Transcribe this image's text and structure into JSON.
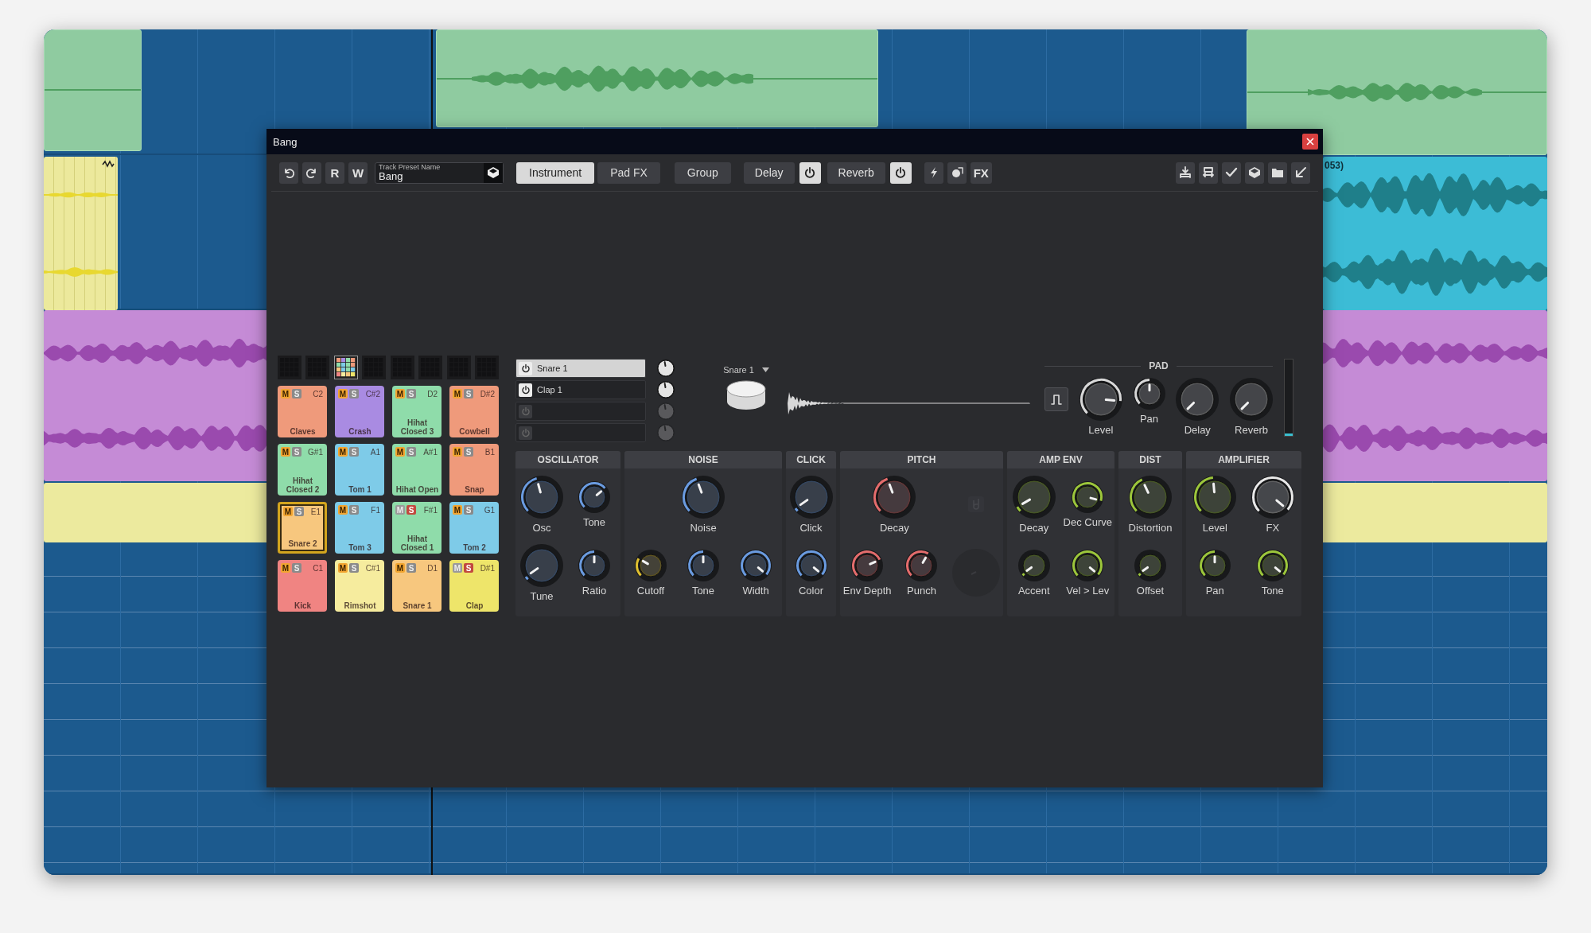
{
  "daw": {
    "clip_label": "053)"
  },
  "window": {
    "title": "Bang"
  },
  "toolbar": {
    "letter_buttons": [
      "R",
      "W"
    ],
    "preset": {
      "label": "Track Preset Name",
      "value": "Bang"
    },
    "tabs": [
      {
        "label": "Instrument",
        "selected": true
      },
      {
        "label": "Pad FX",
        "selected": false
      },
      {
        "label": "Group",
        "selected": false
      }
    ],
    "effects": [
      {
        "label": "Delay",
        "on": true
      },
      {
        "label": "Reverb",
        "on": true
      }
    ],
    "fx_label": "FX"
  },
  "banks": [
    {
      "selected": false
    },
    {
      "selected": false
    },
    {
      "selected": true
    },
    {
      "selected": false
    },
    {
      "selected": false
    },
    {
      "selected": false
    },
    {
      "selected": false
    },
    {
      "selected": false
    }
  ],
  "pads": [
    {
      "m": "M",
      "s": "S",
      "note": "C2",
      "name": "Claves",
      "color": "#ef9a7b",
      "m_on": true,
      "s_on": false,
      "selected": false
    },
    {
      "m": "M",
      "s": "S",
      "note": "C#2",
      "name": "Crash",
      "color": "#a98be2",
      "m_on": true,
      "s_on": false,
      "selected": false
    },
    {
      "m": "M",
      "s": "S",
      "note": "D2",
      "name": "Hihat Closed 3",
      "color": "#8fdcaa",
      "m_on": true,
      "s_on": false,
      "selected": false
    },
    {
      "m": "M",
      "s": "S",
      "note": "D#2",
      "name": "Cowbell",
      "color": "#ef9a7b",
      "m_on": true,
      "s_on": false,
      "selected": false
    },
    {
      "m": "M",
      "s": "S",
      "note": "G#1",
      "name": "Hihat Closed 2",
      "color": "#8fdcaa",
      "m_on": true,
      "s_on": false,
      "selected": false
    },
    {
      "m": "M",
      "s": "S",
      "note": "A1",
      "name": "Tom 1",
      "color": "#7ecbe8",
      "m_on": true,
      "s_on": false,
      "selected": false
    },
    {
      "m": "M",
      "s": "S",
      "note": "A#1",
      "name": "Hihat Open",
      "color": "#8fdcaa",
      "m_on": true,
      "s_on": false,
      "selected": false
    },
    {
      "m": "M",
      "s": "S",
      "note": "B1",
      "name": "Snap",
      "color": "#ef9a7b",
      "m_on": true,
      "s_on": false,
      "selected": false
    },
    {
      "m": "M",
      "s": "S",
      "note": "E1",
      "name": "Snare 2",
      "color": "#f7c77e",
      "m_on": true,
      "s_on": false,
      "selected": true
    },
    {
      "m": "M",
      "s": "S",
      "note": "F1",
      "name": "Tom 3",
      "color": "#7ecbe8",
      "m_on": true,
      "s_on": false,
      "selected": false
    },
    {
      "m": "M",
      "s": "S",
      "note": "F#1",
      "name": "Hihat Closed 1",
      "color": "#8fdcaa",
      "m_on": false,
      "s_on": true,
      "selected": false
    },
    {
      "m": "M",
      "s": "S",
      "note": "G1",
      "name": "Tom 2",
      "color": "#7ecbe8",
      "m_on": true,
      "s_on": false,
      "selected": false
    },
    {
      "m": "M",
      "s": "S",
      "note": "C1",
      "name": "Kick",
      "color": "#f08482",
      "m_on": true,
      "s_on": false,
      "selected": false
    },
    {
      "m": "M",
      "s": "S",
      "note": "C#1",
      "name": "Rimshot",
      "color": "#f6ec9e",
      "m_on": true,
      "s_on": false,
      "selected": false
    },
    {
      "m": "M",
      "s": "S",
      "note": "D1",
      "name": "Snare 1",
      "color": "#f7c77e",
      "m_on": true,
      "s_on": false,
      "selected": false
    },
    {
      "m": "M",
      "s": "S",
      "note": "D#1",
      "name": "Clap",
      "color": "#eee56a",
      "m_on": false,
      "s_on": true,
      "selected": false
    }
  ],
  "layers": [
    {
      "label": "Snare 1",
      "on": true,
      "selected": true
    },
    {
      "label": "Clap 1",
      "on": true,
      "selected": false
    },
    {
      "on": false,
      "selected": false
    },
    {
      "on": false,
      "selected": false
    }
  ],
  "sample": {
    "name": "Snare 1"
  },
  "pad": {
    "title": "PAD",
    "knobs": [
      {
        "label": "Level",
        "kind": "large"
      },
      {
        "label": "Pan",
        "kind": "small"
      },
      {
        "label": "Delay",
        "kind": "large"
      },
      {
        "label": "Reverb",
        "kind": "large"
      }
    ],
    "meter": {
      "level": 0.03
    }
  },
  "sections": [
    {
      "title": "OSCILLATOR",
      "rows": [
        [
          {
            "label": "Osc",
            "kind": "large"
          },
          {
            "label": "Tone",
            "kind": "small"
          }
        ],
        [
          {
            "label": "Tune",
            "kind": "large"
          },
          {
            "label": "Ratio",
            "kind": "small"
          }
        ]
      ]
    },
    {
      "title": "NOISE",
      "rows": [
        [
          "",
          {
            "label": "Noise",
            "kind": "large"
          }
        ],
        [
          {
            "label": "Cutoff",
            "kind": "small"
          },
          {
            "label": "Tone",
            "kind": "small"
          },
          {
            "label": "Width",
            "kind": "small"
          }
        ]
      ]
    },
    {
      "title": "CLICK",
      "rows": [
        [
          {
            "label": "Click",
            "kind": "large"
          }
        ],
        [
          {
            "label": "Color",
            "kind": "small"
          }
        ]
      ]
    },
    {
      "title": "PITCH",
      "rows": [
        [
          {
            "label": "Decay",
            "kind": "large"
          },
          {
            "kind": "ghost-icon"
          }
        ],
        [
          {
            "label": "Env Depth",
            "kind": "small"
          },
          {
            "label": "Punch",
            "kind": "small"
          },
          {
            "kind": "ghost-knob"
          }
        ]
      ]
    },
    {
      "title": "AMP ENV",
      "rows": [
        [
          {
            "label": "Decay",
            "kind": "large"
          },
          {
            "label": "Dec Curve",
            "kind": "small"
          }
        ],
        [
          {
            "label": "Accent",
            "kind": "small"
          },
          {
            "label": "Vel > Lev",
            "kind": "small"
          }
        ]
      ]
    },
    {
      "title": "DIST",
      "rows": [
        [
          {
            "label": "Distortion",
            "kind": "large"
          }
        ],
        [
          {
            "label": "Offset",
            "kind": "small"
          }
        ]
      ]
    },
    {
      "title": "AMPLIFIER",
      "rows": [
        [
          {
            "label": "Level",
            "kind": "large"
          },
          {
            "label": "FX",
            "kind": "large"
          }
        ],
        [
          {
            "label": "Pan",
            "kind": "small"
          },
          {
            "label": "Tone",
            "kind": "small"
          }
        ]
      ]
    }
  ]
}
